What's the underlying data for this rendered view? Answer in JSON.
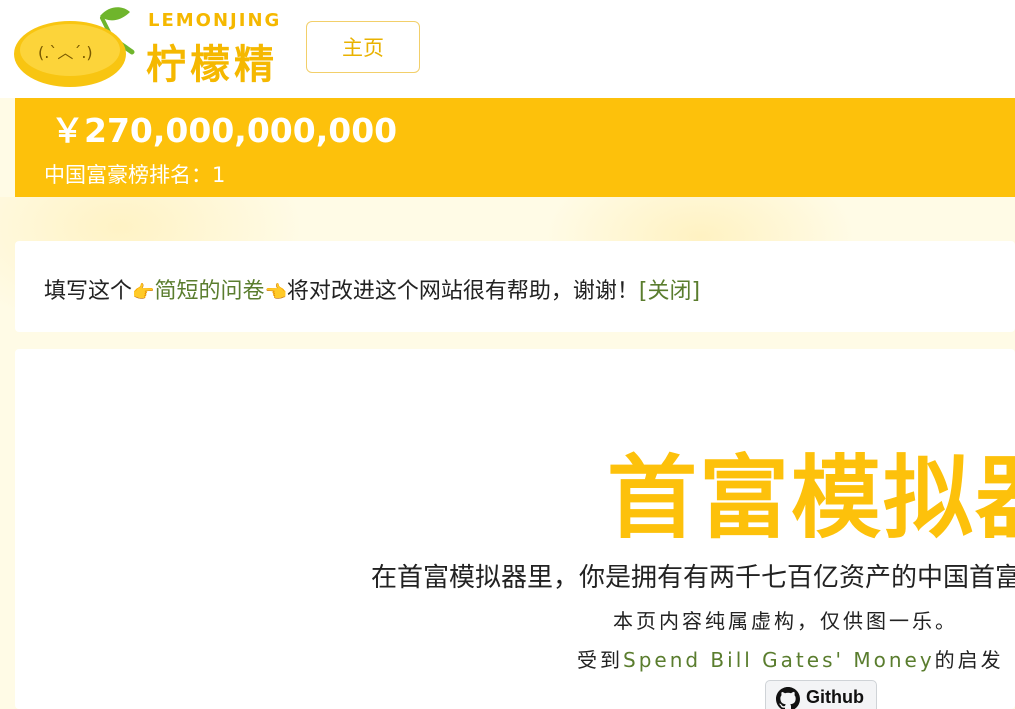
{
  "header": {
    "logo_en": "LEMONJING",
    "logo_cn": "柠檬精",
    "nav": {
      "home_label": "主页"
    }
  },
  "money_bar": {
    "amount": "￥270,000,000,000",
    "rank": "中国富豪榜排名：1"
  },
  "notice": {
    "prefix": "填写这个",
    "survey_link": "简短的问卷",
    "suffix": "将对改进这个网站很有帮助，谢谢！",
    "close_link": "[关闭]"
  },
  "main": {
    "title": "首富模拟器",
    "subtitle": "在首富模拟器里，你是拥有有两千七百亿资产的中国首富",
    "disclaimer": "本页内容纯属虚构，仅供图一乐。",
    "inspired_prefix": "受到",
    "inspired_link": "Spend Bill Gates' Money",
    "inspired_suffix": "的启发",
    "github_label": "Github"
  },
  "colors": {
    "brand_yellow": "#fdc10b",
    "link_green": "#5a7d2e"
  },
  "icons": {
    "logo": "lemon-mascot-icon",
    "pointing_right": "pointing-right-hand-icon",
    "pointing_left": "pointing-left-hand-icon",
    "github": "github-icon"
  }
}
